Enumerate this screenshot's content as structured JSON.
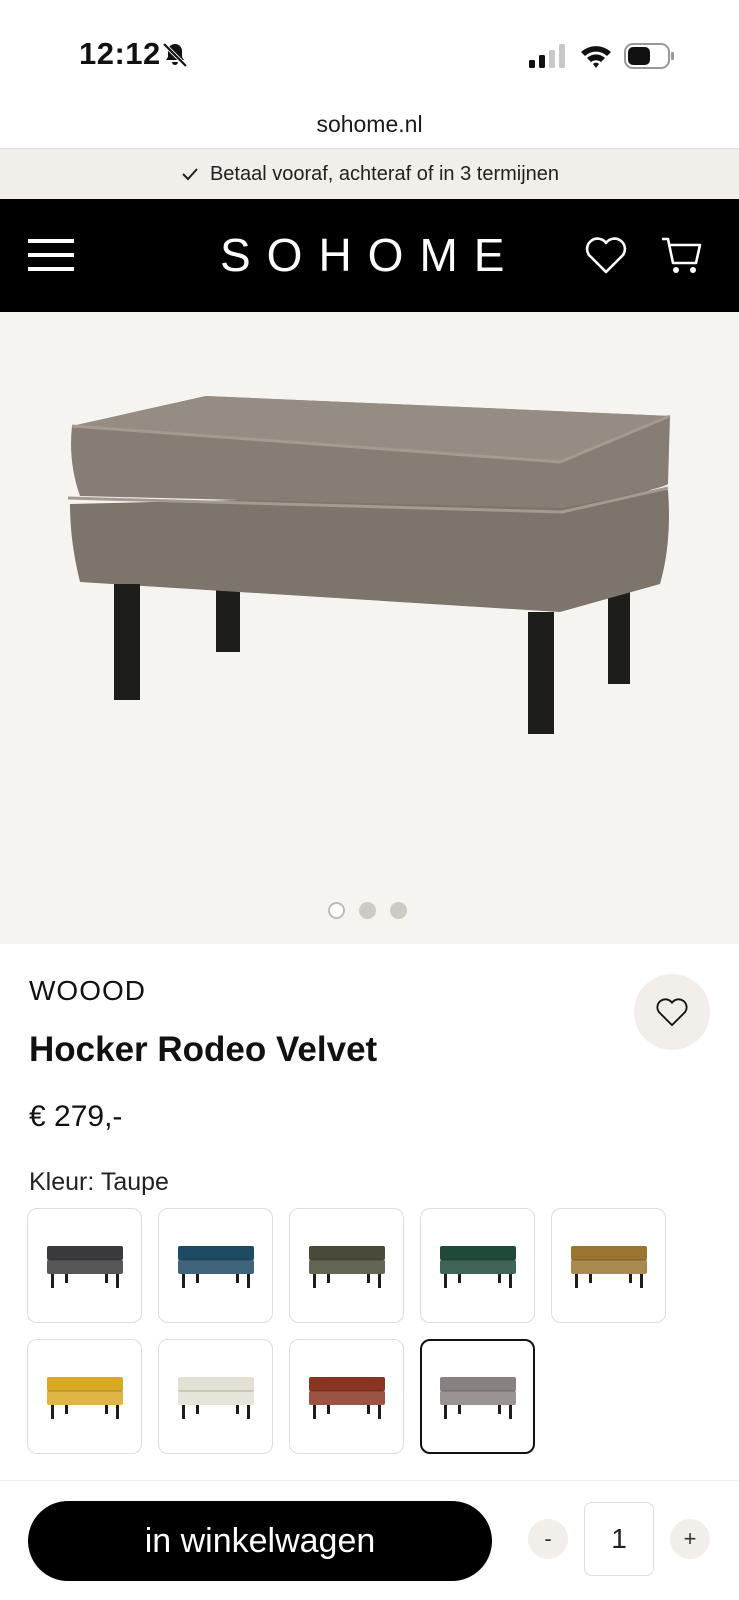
{
  "status_bar": {
    "time": "12:12"
  },
  "browser": {
    "url": "sohome.nl"
  },
  "promo": {
    "text": "Betaal vooraf, achteraf of in 3 termijnen"
  },
  "header": {
    "logo": "SOHOME"
  },
  "gallery": {
    "slides": 3,
    "active_slide": 1
  },
  "product": {
    "brand": "WOOOD",
    "title": "Hocker Rodeo Velvet",
    "price": "€ 279,-",
    "color_label": "Kleur:",
    "color_value": "Taupe",
    "swatches": [
      {
        "color": "#3a3a3c"
      },
      {
        "color": "#1f4a63"
      },
      {
        "color": "#4a4a38"
      },
      {
        "color": "#1f4a38"
      },
      {
        "color": "#9a7530"
      },
      {
        "color": "#d9a824"
      },
      {
        "color": "#e3dfd2"
      },
      {
        "color": "#8a3522"
      },
      {
        "color": "#878180",
        "selected": true
      }
    ]
  },
  "actions": {
    "add_to_cart": "in winkelwagen",
    "qty_minus": "-",
    "qty_value": "1",
    "qty_plus": "+"
  },
  "icons": [
    "bell-muted-icon",
    "signal-icon",
    "wifi-icon",
    "battery-icon",
    "check-icon",
    "menu-icon",
    "heart-icon",
    "cart-icon"
  ]
}
